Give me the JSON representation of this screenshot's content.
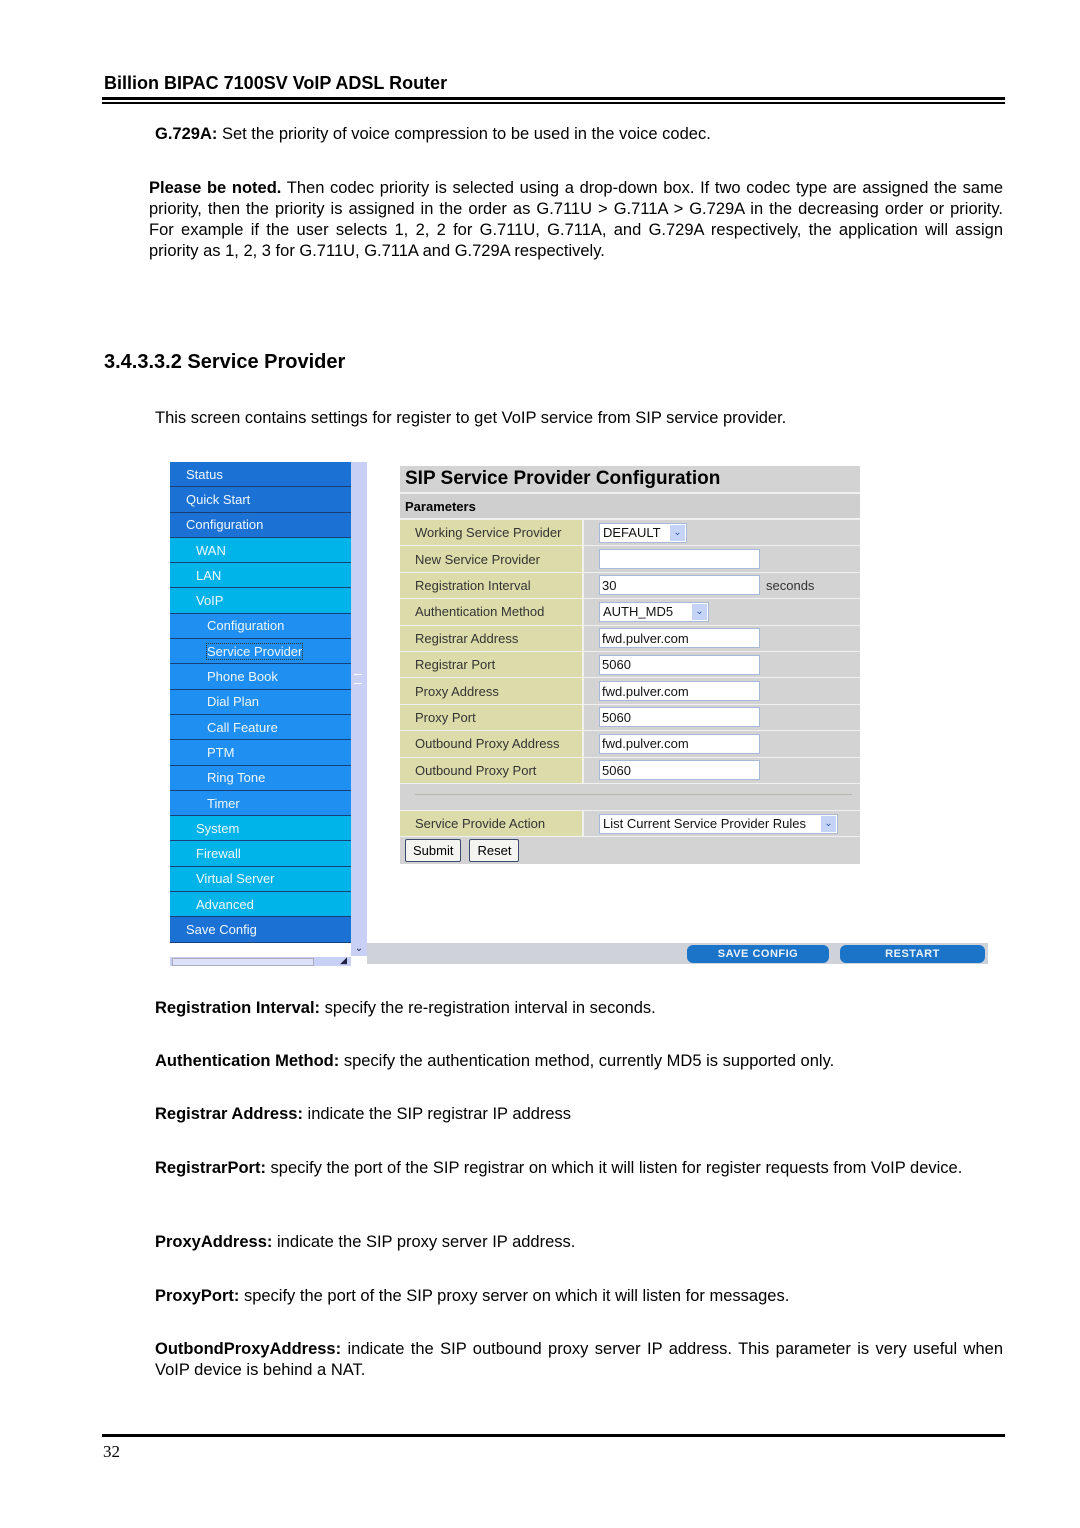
{
  "doc": {
    "header": "Billion BIPAC 7100SV VoIP ADSL Router",
    "page_number": "32",
    "g729": {
      "term": "G.729A:",
      "text": " Set the priority of voice compression to be used in the voice codec."
    },
    "note": {
      "term": "Please be noted.",
      "text": " Then codec priority is selected using a drop-down box. If two codec type are assigned the same priority, then the priority is assigned in the order as G.711U > G.711A > G.729A in the decreasing order or priority. For example if the user selects 1, 2, 2 for G.711U, G.711A, and G.729A respectively, the application will assign priority as 1, 2, 3 for G.711U, G.711A and G.729A respectively."
    },
    "section_title": "3.4.3.3.2 Service Provider",
    "intro": "This screen contains settings for register to get VoIP service from SIP service provider.",
    "descriptions": [
      {
        "term": "Registration Interval:",
        "text": " specify the re-registration interval in seconds."
      },
      {
        "term": "Authentication Method:",
        "text": " specify the authentication method, currently MD5 is supported only."
      },
      {
        "term": "Registrar Address:",
        "text": " indicate the SIP registrar IP address"
      },
      {
        "term": "RegistrarPort:",
        "text": " specify the port of the SIP registrar on which it will listen for register requests from VoIP device."
      },
      {
        "term": "ProxyAddress:",
        "text": " indicate the SIP proxy server IP address."
      },
      {
        "term": "ProxyPort:",
        "text": " specify the port of the SIP proxy server on which it will listen for messages."
      },
      {
        "term": "OutbondProxyAddress:",
        "text": " indicate the SIP outbound proxy server IP address. This parameter is very useful when VoIP device is behind a NAT."
      }
    ]
  },
  "screenshot": {
    "sidebar": [
      {
        "label": "Status",
        "level": 0
      },
      {
        "label": "Quick Start",
        "level": 0
      },
      {
        "label": "Configuration",
        "level": 0
      },
      {
        "label": "WAN",
        "level": 1
      },
      {
        "label": "LAN",
        "level": 1
      },
      {
        "label": "VoIP",
        "level": 1
      },
      {
        "label": "Configuration",
        "level": 2
      },
      {
        "label": "Service Provider",
        "level": 2,
        "active": true
      },
      {
        "label": "Phone Book",
        "level": 2
      },
      {
        "label": "Dial Plan",
        "level": 2
      },
      {
        "label": "Call Feature",
        "level": 2
      },
      {
        "label": "PTM",
        "level": 2
      },
      {
        "label": "Ring Tone",
        "level": 2
      },
      {
        "label": "Timer",
        "level": 2
      },
      {
        "label": "System",
        "level": 1
      },
      {
        "label": "Firewall",
        "level": 1
      },
      {
        "label": "Virtual Server",
        "level": 1
      },
      {
        "label": "Advanced",
        "level": 1
      },
      {
        "label": "Save Config",
        "level": 0
      }
    ],
    "panel": {
      "title": "SIP Service Provider Configuration",
      "subtitle": "Parameters",
      "fields": {
        "working_provider": {
          "label": "Working Service Provider",
          "value": "DEFAULT"
        },
        "new_provider": {
          "label": "New Service Provider",
          "value": ""
        },
        "reg_interval": {
          "label": "Registration Interval",
          "value": "30",
          "unit": "seconds"
        },
        "auth_method": {
          "label": "Authentication Method",
          "value": "AUTH_MD5"
        },
        "registrar_address": {
          "label": "Registrar Address",
          "value": "fwd.pulver.com"
        },
        "registrar_port": {
          "label": "Registrar Port",
          "value": "5060"
        },
        "proxy_address": {
          "label": "Proxy Address",
          "value": "fwd.pulver.com"
        },
        "proxy_port": {
          "label": "Proxy Port",
          "value": "5060"
        },
        "outbound_proxy_address": {
          "label": "Outbound Proxy Address",
          "value": "fwd.pulver.com"
        },
        "outbound_proxy_port": {
          "label": "Outbound Proxy Port",
          "value": "5060"
        },
        "action": {
          "label": "Service Provide Action",
          "value": "List Current Service Provider Rules"
        }
      },
      "submit_label": "Submit",
      "reset_label": "Reset"
    },
    "bottom": {
      "save_label": "SAVE CONFIG",
      "restart_label": "RESTART"
    },
    "colors": {
      "nav_top": "#1c72d4",
      "nav_sub": "#00b4ea",
      "nav_voip": "#1f8ff2",
      "label_bg": "#dcdcaa",
      "panel_bg": "#d3d3d3"
    }
  }
}
